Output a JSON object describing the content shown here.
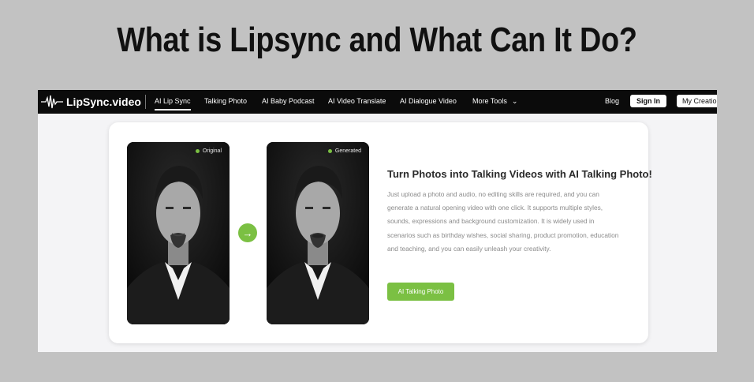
{
  "headline": "What is Lipsync and What Can It Do?",
  "nav": {
    "logo_text": "LipSync.video",
    "items": [
      "AI Lip Sync",
      "Talking Photo",
      "AI Baby Podcast",
      "AI Video Translate",
      "AI Dialogue Video",
      "More Tools"
    ],
    "blog": "Blog",
    "sign_in": "Sign In",
    "my_creations": "My Creatio"
  },
  "card": {
    "original_badge": "Original",
    "generated_badge": "Generated",
    "arrow_icon": "arrow-right-icon",
    "title": "Turn Photos into Talking Videos with AI Talking Photo!",
    "description": "Just upload a photo and audio, no editing skills are required, and you can generate a natural opening video with one click. It supports multiple styles, sounds, expressions and background customization. It is widely used in scenarios such as birthday wishes, social sharing, product promotion, education and teaching, and you can easily unleash your creativity.",
    "cta": "AI Talking Photo"
  },
  "colors": {
    "accent": "#7bc043",
    "nav_bg": "#0b0b0b",
    "page_bg": "#c2c2c2"
  }
}
